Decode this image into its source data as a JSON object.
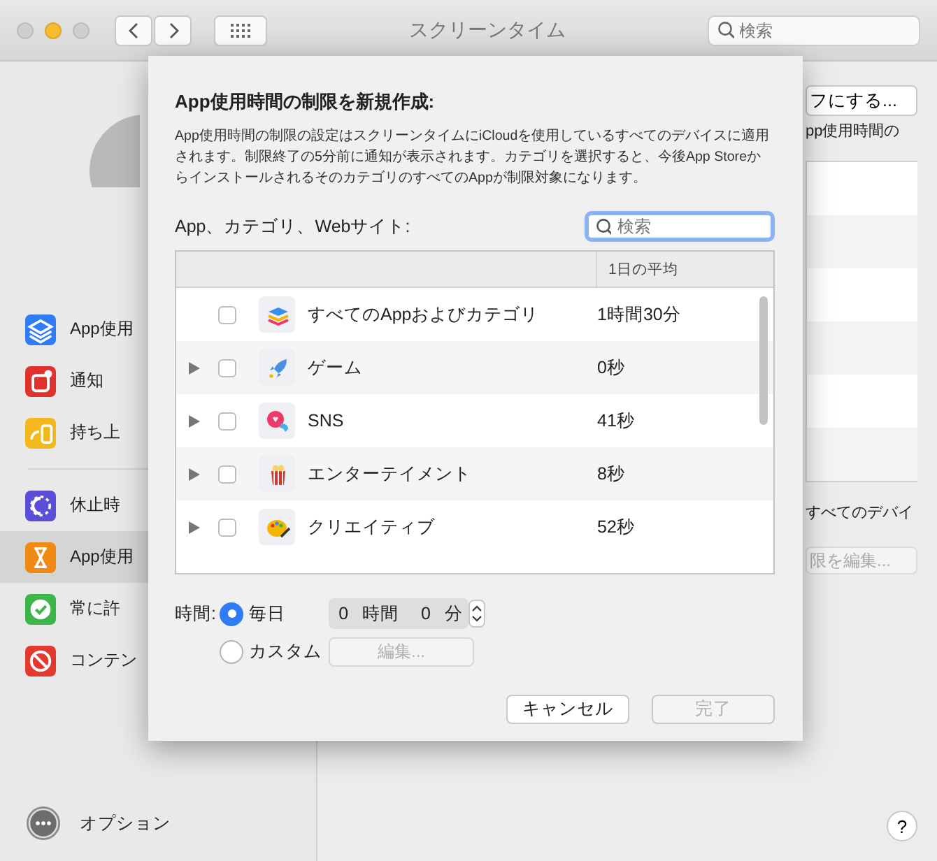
{
  "window": {
    "title": "スクリーンタイム",
    "search": {
      "placeholder": "検索"
    }
  },
  "sidebar": {
    "groups": [
      [
        {
          "label": "App使用",
          "selected": false
        },
        {
          "label": "通知",
          "selected": false
        },
        {
          "label": "持ち上",
          "selected": false
        }
      ],
      [
        {
          "label": "休止時",
          "selected": false
        },
        {
          "label": "App使用",
          "selected": true
        },
        {
          "label": "常に許",
          "selected": false
        },
        {
          "label": "コンテン",
          "selected": false
        }
      ]
    ],
    "options": "オプション"
  },
  "right_pane": {
    "button": "フにする...",
    "text_1": "pp使用時間の",
    "text_2": "すべてのデバイ",
    "edit_button": "限を編集..."
  },
  "sheet": {
    "title": "App使用時間の制限を新規作成:",
    "description": "App使用時間の制限の設定はスクリーンタイムにiCloudを使用しているすべてのデバイスに適用されます。制限終了の5分前に通知が表示されます。カテゴリを選択すると、今後App StoreからインストールされるそのカテゴリのすべてのAppが制限対象になります。",
    "list_label": "App、カテゴリ、Webサイト:",
    "search": {
      "placeholder": "検索"
    },
    "table": {
      "columns": [
        "1日の平均"
      ],
      "rows": [
        {
          "name": "すべてのAppおよびカテゴリ",
          "average": "1時間30分",
          "expandable": false,
          "checked": false
        },
        {
          "name": "ゲーム",
          "average": "0秒",
          "expandable": true,
          "checked": false
        },
        {
          "name": "SNS",
          "average": "41秒",
          "expandable": true,
          "checked": false
        },
        {
          "name": "エンターテイメント",
          "average": "8秒",
          "expandable": true,
          "checked": false
        },
        {
          "name": "クリエイティブ",
          "average": "52秒",
          "expandable": true,
          "checked": false
        }
      ]
    },
    "time_label": "時間:",
    "options": [
      {
        "label": "毎日",
        "selected": true
      },
      {
        "label": "カスタム",
        "selected": false
      }
    ],
    "hours": "0",
    "hours_unit": "時間",
    "minutes": "0",
    "minutes_unit": "分",
    "edit_button": {
      "label": "編集...",
      "disabled": true
    },
    "buttons": [
      {
        "label": "キャンセル",
        "disabled": false
      },
      {
        "label": "完了",
        "disabled": true
      }
    ]
  },
  "help": "?"
}
